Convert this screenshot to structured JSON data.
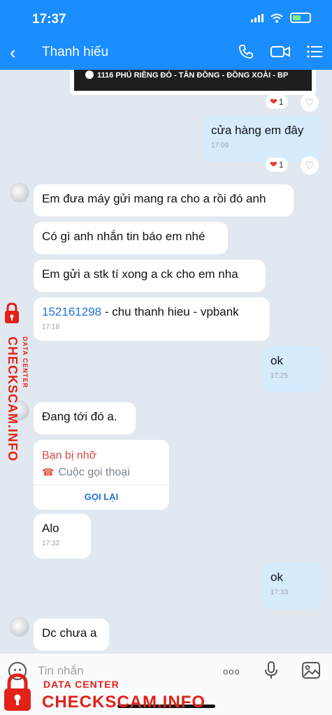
{
  "status_bar": {
    "time": "17:37"
  },
  "header": {
    "back_icon": "chevron-left-icon",
    "contact_name": "Thanh hiếu",
    "icons": [
      "phone-icon",
      "video-icon",
      "menu-icon"
    ]
  },
  "pinned_card": {
    "text": "1116 PHÚ RIỀNG ĐỎ - TÂN ĐỒNG - ĐỒNG XOÀI - BP"
  },
  "reactions": {
    "count_1": "1",
    "count_2": "1"
  },
  "messages": {
    "m1": {
      "text": "cửa hàng em đây",
      "time": "17:09"
    },
    "m2": {
      "text": "Em đưa máy gửi mang ra cho a rồi đó anh"
    },
    "m3": {
      "text": "Có gì anh nhắn tin báo em nhé"
    },
    "m4": {
      "text": "Em gửi a stk tí xong a ck cho em nha"
    },
    "m5": {
      "account": "152161298",
      "rest": " - chu thanh hieu - vpbank",
      "time": "17:18"
    },
    "m6": {
      "text": "ok",
      "time": "17:25"
    },
    "m7": {
      "text": "Đang tới đó a."
    },
    "m8": {
      "title": "Bạn bị nhỡ",
      "subtitle": "Cuộc gọi thoại",
      "action": "GỌI LẠI"
    },
    "m9": {
      "text": "Alo",
      "time": "17:32"
    },
    "m10": {
      "text": "ok",
      "time": "17:33"
    },
    "m11": {
      "text": "Dc chưa a"
    }
  },
  "composer": {
    "placeholder": "Tin nhắn",
    "more_label": "ooo"
  },
  "watermark": {
    "main": "CHECKSCAM.INFO",
    "sub": "DATA CENTER"
  },
  "colors": {
    "header": "#1a8dff",
    "background": "#e2e8ef",
    "my_bubble": "#d5ecfe",
    "watermark": "#e32119",
    "link": "#1f73d8",
    "missed_call": "#d94a4a"
  }
}
